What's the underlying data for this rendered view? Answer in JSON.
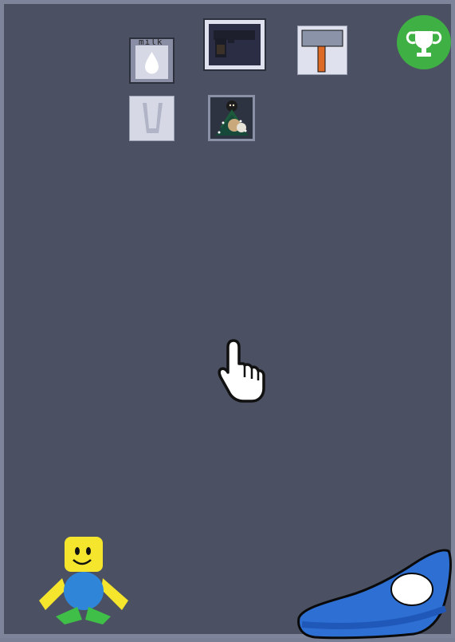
{
  "inventory": {
    "milk": {
      "label": "milk",
      "icon": "milk-carton-icon"
    },
    "gun": {
      "icon": "pistol-icon"
    },
    "hammer": {
      "icon": "hammer-icon"
    },
    "cup": {
      "icon": "glass-cup-icon"
    },
    "tree": {
      "icon": "christmas-tree-icon"
    }
  },
  "hud": {
    "trophy_icon": "trophy-icon",
    "cursor_icon": "pointer-hand-icon",
    "character_icon": "noob-avatar-icon",
    "shoe_icon": "sneaker-icon"
  },
  "colors": {
    "background": "#4b5162",
    "border": "#7e8499",
    "trophy_bg": "#3fb043",
    "noob_yellow": "#f5e52c",
    "noob_blue": "#2f86d8",
    "noob_green": "#3fbf47",
    "shoe_blue": "#2e6fd4"
  }
}
